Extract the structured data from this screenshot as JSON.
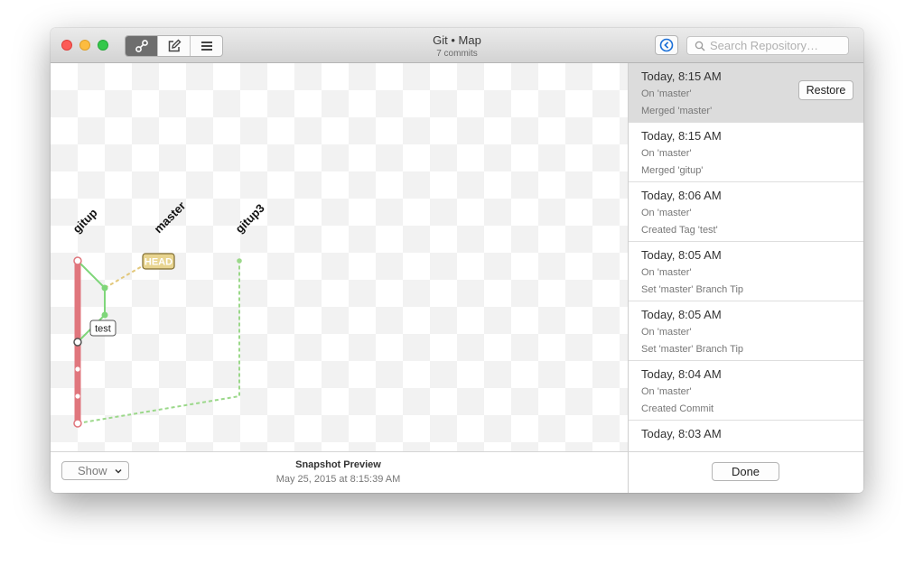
{
  "window": {
    "title": "Git • Map",
    "subtitle": "7 commits"
  },
  "toolbar": {
    "view_modes": [
      {
        "icon": "map-icon",
        "active": true
      },
      {
        "icon": "edit-icon",
        "active": false
      },
      {
        "icon": "list-icon",
        "active": false
      }
    ],
    "back_icon": "back-arrow-icon",
    "search": {
      "placeholder": "Search Repository…",
      "value": ""
    }
  },
  "graph": {
    "branches": [
      "gitup",
      "master",
      "gitup3"
    ],
    "head_label": "HEAD",
    "tag_label": "test",
    "colors": {
      "gitup": "#e0767d",
      "master": "#7fd67a",
      "head_line": "#e2c77a",
      "gitup3": "#9bd88a"
    }
  },
  "footer": {
    "show_select": "Show",
    "preview_title": "Snapshot Preview",
    "preview_date": "May 25, 2015 at 8:15:39 AM",
    "done_label": "Done"
  },
  "snapshots": [
    {
      "date": "Today, 8:15 AM",
      "branch": "On 'master'",
      "action": "Merged 'master'",
      "selected": true,
      "restore_label": "Restore"
    },
    {
      "date": "Today, 8:15 AM",
      "branch": "On 'master'",
      "action": "Merged 'gitup'"
    },
    {
      "date": "Today, 8:06 AM",
      "branch": "On 'master'",
      "action": "Created Tag 'test'"
    },
    {
      "date": "Today, 8:05 AM",
      "branch": "On 'master'",
      "action": "Set 'master' Branch Tip"
    },
    {
      "date": "Today, 8:05 AM",
      "branch": "On 'master'",
      "action": "Set 'master' Branch Tip"
    },
    {
      "date": "Today, 8:04 AM",
      "branch": "On 'master'",
      "action": "Created Commit"
    },
    {
      "date": "Today, 8:03 AM",
      "branch": "",
      "action": ""
    }
  ]
}
